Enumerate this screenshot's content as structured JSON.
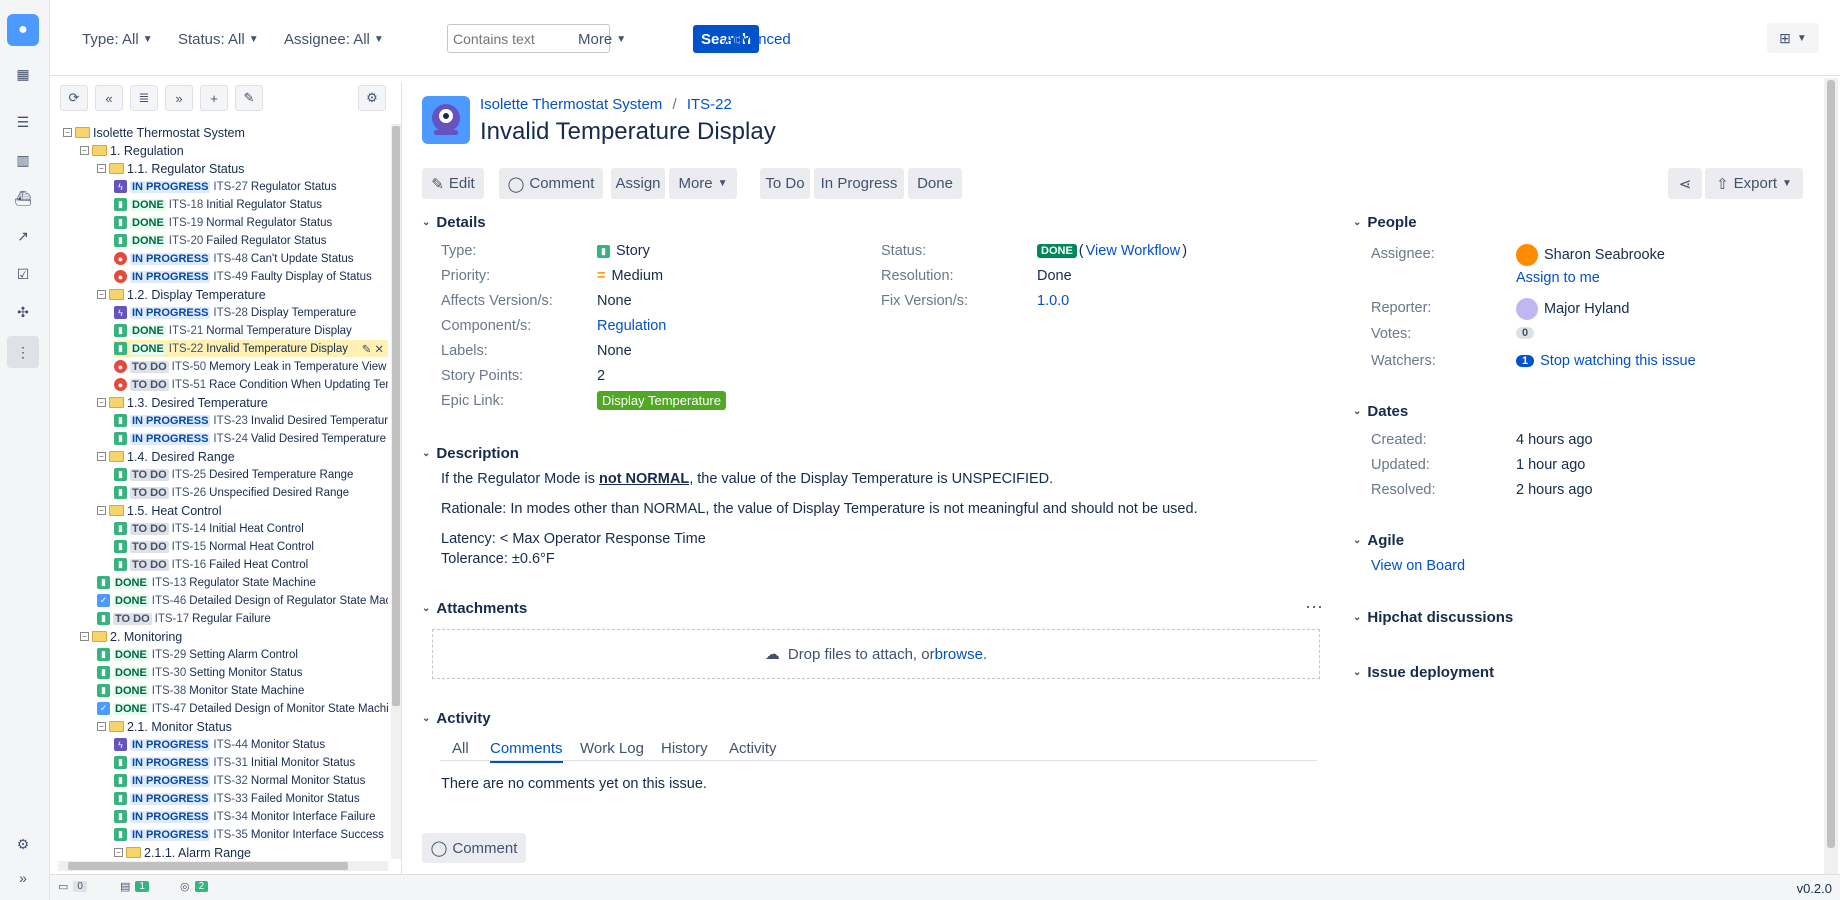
{
  "topbar": {
    "type_filter": "Type: All",
    "status_filter": "Status: All",
    "assignee_filter": "Assignee: All",
    "search_placeholder": "Contains text",
    "more": "More",
    "search_btn": "Search",
    "advanced": "Advanced"
  },
  "tree": {
    "rows": [
      {
        "indent": 0,
        "kind": "folder",
        "label": "Isolette Thermostat System"
      },
      {
        "indent": 1,
        "kind": "folder",
        "label": "1. Regulation"
      },
      {
        "indent": 2,
        "kind": "folder",
        "label": "1.1. Regulator Status"
      },
      {
        "indent": 3,
        "kind": "issue",
        "type": "epic",
        "status": "IN PROGRESS",
        "key": "ITS-27",
        "label": "Regulator Status"
      },
      {
        "indent": 3,
        "kind": "issue",
        "type": "story",
        "status": "DONE",
        "key": "ITS-18",
        "label": "Initial Regulator Status"
      },
      {
        "indent": 3,
        "kind": "issue",
        "type": "story",
        "status": "DONE",
        "key": "ITS-19",
        "label": "Normal Regulator Status"
      },
      {
        "indent": 3,
        "kind": "issue",
        "type": "story",
        "status": "DONE",
        "key": "ITS-20",
        "label": "Failed Regulator Status"
      },
      {
        "indent": 3,
        "kind": "issue",
        "type": "bug",
        "status": "IN PROGRESS",
        "key": "ITS-48",
        "label": "Can't Update Status"
      },
      {
        "indent": 3,
        "kind": "issue",
        "type": "bug",
        "status": "IN PROGRESS",
        "key": "ITS-49",
        "label": "Faulty Display of Status"
      },
      {
        "indent": 2,
        "kind": "folder",
        "label": "1.2. Display Temperature"
      },
      {
        "indent": 3,
        "kind": "issue",
        "type": "epic",
        "status": "IN PROGRESS",
        "key": "ITS-28",
        "label": "Display Temperature"
      },
      {
        "indent": 3,
        "kind": "issue",
        "type": "story",
        "status": "DONE",
        "key": "ITS-21",
        "label": "Normal Temperature Display"
      },
      {
        "indent": 3,
        "kind": "issue",
        "type": "story",
        "status": "DONE",
        "key": "ITS-22",
        "label": "Invalid Temperature Display",
        "selected": true
      },
      {
        "indent": 3,
        "kind": "issue",
        "type": "bug",
        "status": "TO DO",
        "key": "ITS-50",
        "label": "Memory Leak in Temperature View"
      },
      {
        "indent": 3,
        "kind": "issue",
        "type": "bug",
        "status": "TO DO",
        "key": "ITS-51",
        "label": "Race Condition When Updating Tem"
      },
      {
        "indent": 2,
        "kind": "folder",
        "label": "1.3. Desired Temperature"
      },
      {
        "indent": 3,
        "kind": "issue",
        "type": "story",
        "status": "IN PROGRESS",
        "key": "ITS-23",
        "label": "Invalid Desired Temperatur"
      },
      {
        "indent": 3,
        "kind": "issue",
        "type": "story",
        "status": "IN PROGRESS",
        "key": "ITS-24",
        "label": "Valid Desired Temperature"
      },
      {
        "indent": 2,
        "kind": "folder",
        "label": "1.4. Desired Range"
      },
      {
        "indent": 3,
        "kind": "issue",
        "type": "story",
        "status": "TO DO",
        "key": "ITS-25",
        "label": "Desired Temperature Range"
      },
      {
        "indent": 3,
        "kind": "issue",
        "type": "story",
        "status": "TO DO",
        "key": "ITS-26",
        "label": "Unspecified Desired Range"
      },
      {
        "indent": 2,
        "kind": "folder",
        "label": "1.5. Heat Control"
      },
      {
        "indent": 3,
        "kind": "issue",
        "type": "story",
        "status": "TO DO",
        "key": "ITS-14",
        "label": "Initial Heat Control"
      },
      {
        "indent": 3,
        "kind": "issue",
        "type": "story",
        "status": "TO DO",
        "key": "ITS-15",
        "label": "Normal Heat Control"
      },
      {
        "indent": 3,
        "kind": "issue",
        "type": "story",
        "status": "TO DO",
        "key": "ITS-16",
        "label": "Failed Heat Control"
      },
      {
        "indent": 2,
        "kind": "issue",
        "type": "story",
        "status": "DONE",
        "key": "ITS-13",
        "label": "Regulator State Machine"
      },
      {
        "indent": 2,
        "kind": "issue",
        "type": "task",
        "status": "DONE",
        "key": "ITS-46",
        "label": "Detailed Design of Regulator State Machi"
      },
      {
        "indent": 2,
        "kind": "issue",
        "type": "story",
        "status": "TO DO",
        "key": "ITS-17",
        "label": "Regular Failure"
      },
      {
        "indent": 1,
        "kind": "folder",
        "label": "2. Monitoring"
      },
      {
        "indent": 2,
        "kind": "issue",
        "type": "story",
        "status": "DONE",
        "key": "ITS-29",
        "label": "Setting Alarm Control"
      },
      {
        "indent": 2,
        "kind": "issue",
        "type": "story",
        "status": "DONE",
        "key": "ITS-30",
        "label": "Setting Monitor Status"
      },
      {
        "indent": 2,
        "kind": "issue",
        "type": "story",
        "status": "DONE",
        "key": "ITS-38",
        "label": "Monitor State Machine"
      },
      {
        "indent": 2,
        "kind": "issue",
        "type": "task",
        "status": "DONE",
        "key": "ITS-47",
        "label": "Detailed Design of Monitor State Machine"
      },
      {
        "indent": 2,
        "kind": "folder",
        "label": "2.1. Monitor Status"
      },
      {
        "indent": 3,
        "kind": "issue",
        "type": "epic",
        "status": "IN PROGRESS",
        "key": "ITS-44",
        "label": "Monitor Status"
      },
      {
        "indent": 3,
        "kind": "issue",
        "type": "story",
        "status": "IN PROGRESS",
        "key": "ITS-31",
        "label": "Initial Monitor Status"
      },
      {
        "indent": 3,
        "kind": "issue",
        "type": "story",
        "status": "IN PROGRESS",
        "key": "ITS-32",
        "label": "Normal Monitor Status"
      },
      {
        "indent": 3,
        "kind": "issue",
        "type": "story",
        "status": "IN PROGRESS",
        "key": "ITS-33",
        "label": "Failed Monitor Status"
      },
      {
        "indent": 3,
        "kind": "issue",
        "type": "story",
        "status": "IN PROGRESS",
        "key": "ITS-34",
        "label": "Monitor Interface Failure"
      },
      {
        "indent": 3,
        "kind": "issue",
        "type": "story",
        "status": "IN PROGRESS",
        "key": "ITS-35",
        "label": "Monitor Interface Success"
      },
      {
        "indent": 3,
        "kind": "folder",
        "label": "2.1.1. Alarm Range"
      }
    ]
  },
  "statusbar": {
    "folders": "0",
    "issues": "1",
    "other": "2",
    "version": "v0.2.0"
  },
  "issue": {
    "project": "Isolette Thermostat System",
    "key": "ITS-22",
    "title": "Invalid Temperature Display",
    "actions": {
      "edit": "Edit",
      "comment": "Comment",
      "assign": "Assign",
      "more": "More",
      "todo": "To Do",
      "inprogress": "In Progress",
      "done": "Done",
      "export": "Export"
    },
    "details_h": "Details",
    "fields": {
      "type_l": "Type:",
      "type_v": "Story",
      "priority_l": "Priority:",
      "priority_v": "Medium",
      "affects_l": "Affects Version/s:",
      "affects_v": "None",
      "component_l": "Component/s:",
      "component_v": "Regulation",
      "labels_l": "Labels:",
      "labels_v": "None",
      "points_l": "Story Points:",
      "points_v": "2",
      "epic_l": "Epic Link:",
      "epic_v": "Display Temperature",
      "status_l": "Status:",
      "status_v": "DONE",
      "workflow": "View Workflow",
      "resolution_l": "Resolution:",
      "resolution_v": "Done",
      "fix_l": "Fix Version/s:",
      "fix_v": "1.0.0"
    },
    "description_h": "Description",
    "desc1_a": "If the Regulator Mode is ",
    "desc1_b": "not NORMAL",
    "desc1_c": ", the value of the Display Temperature is UNSPECIFIED.",
    "desc2": "Rationale: In modes other than NORMAL, the value of Display Temperature is not meaningful and should not  be used.",
    "desc3": "Latency: < Max Operator Response Time",
    "desc4": "Tolerance: ±0.6°F",
    "attachments_h": "Attachments",
    "drop_text": "Drop files to attach, or ",
    "browse": "browse.",
    "activity_h": "Activity",
    "tabs": {
      "all": "All",
      "comments": "Comments",
      "worklog": "Work Log",
      "history": "History",
      "activity": "Activity"
    },
    "no_comments": "There are no comments yet on this issue.",
    "comment_btn": "Comment"
  },
  "people": {
    "h": "People",
    "assignee_l": "Assignee:",
    "assignee_v": "Sharon Seabrooke",
    "assign_me": "Assign to me",
    "reporter_l": "Reporter:",
    "reporter_v": "Major Hyland",
    "votes_l": "Votes:",
    "votes_v": "0",
    "watchers_l": "Watchers:",
    "watchers_v": "1",
    "stop_watch": "Stop watching this issue"
  },
  "dates": {
    "h": "Dates",
    "created_l": "Created:",
    "created_v": "4 hours ago",
    "updated_l": "Updated:",
    "updated_v": "1 hour ago",
    "resolved_l": "Resolved:",
    "resolved_v": "2 hours ago"
  },
  "agile": {
    "h": "Agile",
    "board": "View on Board"
  },
  "hipchat": "Hipchat discussions",
  "deployment": "Issue deployment",
  "colors": {
    "brand": "#0052cc",
    "done": "#00875a",
    "epic": "#51a825"
  }
}
